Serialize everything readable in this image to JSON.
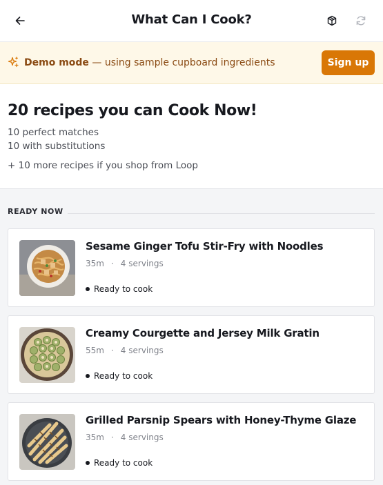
{
  "header": {
    "title": "What Can I Cook?",
    "back_icon": "arrow-left-icon",
    "box_icon": "package-icon",
    "refresh_icon": "refresh-icon"
  },
  "banner": {
    "icon": "sparkle-icon",
    "mode_label": "Demo mode",
    "separator": "—",
    "description": "using sample cupboard ingredients",
    "signup_label": "Sign up",
    "accent_color": "#d97706"
  },
  "summary": {
    "headline": "20 recipes you can Cook Now!",
    "perfect_matches": "10 perfect matches",
    "substitutions": "10 with substitutions",
    "more_recipes": "+ 10 more recipes if you shop from Loop"
  },
  "section": {
    "label": "READY NOW"
  },
  "recipes": [
    {
      "title": "Sesame Ginger Tofu Stir-Fry with Noodles",
      "time": "35m",
      "separator": "·",
      "servings": "4 servings",
      "status": "Ready to cook"
    },
    {
      "title": "Creamy Courgette and Jersey Milk Gratin",
      "time": "55m",
      "separator": "·",
      "servings": "4 servings",
      "status": "Ready to cook"
    },
    {
      "title": "Grilled Parsnip Spears with Honey-Thyme Glaze",
      "time": "35m",
      "separator": "·",
      "servings": "4 servings",
      "status": "Ready to cook"
    }
  ]
}
